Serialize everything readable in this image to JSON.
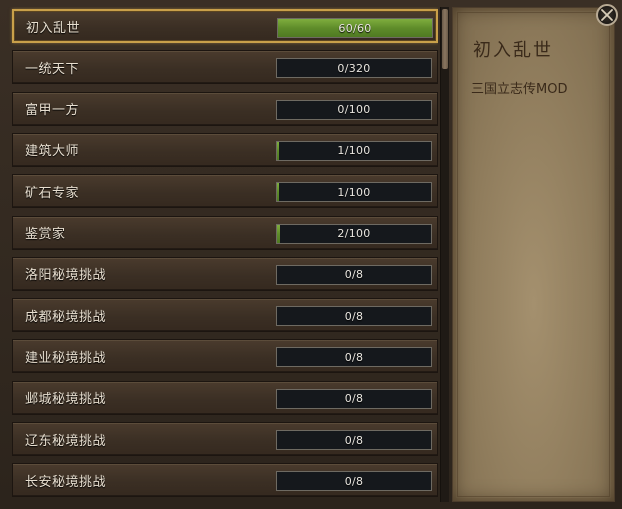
{
  "achievements": [
    {
      "label": "初入乱世",
      "progress": "60/60",
      "fill": 1.0,
      "selected": true
    },
    {
      "label": "一统天下",
      "progress": "0/320",
      "fill": 0
    },
    {
      "label": "富甲一方",
      "progress": "0/100",
      "fill": 0
    },
    {
      "label": "建筑大师",
      "progress": "1/100",
      "fill": 0.01
    },
    {
      "label": "矿石专家",
      "progress": "1/100",
      "fill": 0.01
    },
    {
      "label": "鉴赏家",
      "progress": "2/100",
      "fill": 0.02
    },
    {
      "label": "洛阳秘境挑战",
      "progress": "0/8",
      "fill": 0
    },
    {
      "label": "成都秘境挑战",
      "progress": "0/8",
      "fill": 0
    },
    {
      "label": "建业秘境挑战",
      "progress": "0/8",
      "fill": 0
    },
    {
      "label": "邺城秘境挑战",
      "progress": "0/8",
      "fill": 0
    },
    {
      "label": "辽东秘境挑战",
      "progress": "0/8",
      "fill": 0
    },
    {
      "label": "长安秘境挑战",
      "progress": "0/8",
      "fill": 0
    }
  ],
  "detail": {
    "title": "初入乱世",
    "description": "三国立志传MOD"
  },
  "icons": {
    "close": "close-icon"
  },
  "colors": {
    "selected_border": "#c9a04a",
    "bar_fill": "#6a9a30",
    "parchment": "#9a8766"
  }
}
